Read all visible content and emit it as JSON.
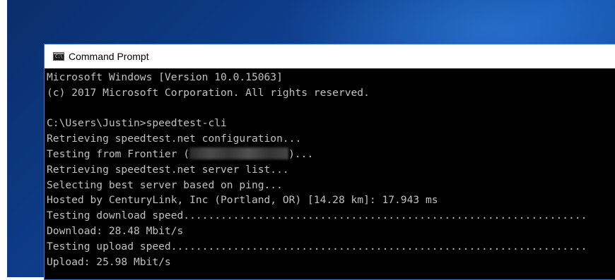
{
  "window": {
    "title": "Command Prompt",
    "icon": "cmd-icon"
  },
  "console": {
    "lines": [
      "Microsoft Windows [Version 10.0.15063]",
      "(c) 2017 Microsoft Corporation. All rights reserved.",
      "",
      "C:\\Users\\Justin>speedtest-cli",
      "Retrieving speedtest.net configuration...",
      {
        "before": "Testing from Frontier (",
        "after": ")..."
      },
      "Retrieving speedtest.net server list...",
      "Selecting best server based on ping...",
      "Hosted by CenturyLink, Inc (Portland, OR) [14.28 km]: 17.943 ms",
      "Testing download speed.................................................................",
      "Download: 28.48 Mbit/s",
      "Testing upload speed...................................................................",
      "Upload: 25.98 Mbit/s"
    ]
  },
  "colors": {
    "console_bg": "#000000",
    "console_text": "#c0c0c0",
    "titlebar_bg": "#ffffff",
    "desktop": "#0e3e8d"
  }
}
